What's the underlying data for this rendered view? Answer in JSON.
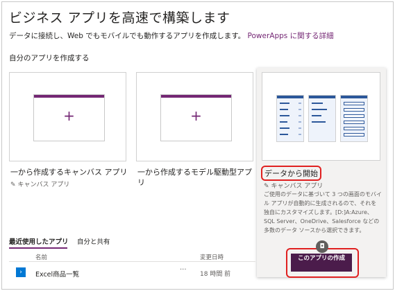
{
  "header": {
    "title": "ビジネス アプリを高速で構築します",
    "subtitle": "データに接続し、Web でもモバイルでも動作するアプリを作成します。",
    "learn_more_link": "PowerApps に関する詳細"
  },
  "create_section": {
    "title": "自分のアプリを作成する",
    "cards": [
      {
        "label": "一から作成するキャンバス アプリ",
        "sub": "キャンバス アプリ",
        "plus_icon": "+"
      },
      {
        "label": "一から作成するモデル駆動型アプリ",
        "plus_icon": "+"
      },
      {
        "label": "データから開始",
        "sub": "キャンバス アプリ",
        "description": "ご使用のデータに基づいて 3 つの画面のモバイル アプリが自動的に生成されるので、それを独自にカスタマイズします。[D:]A:Azure、SQL Server、OneDrive、Salesforce などの多数のデータ ソースから選択できます。",
        "button_label": "このアプリの作成"
      }
    ]
  },
  "tabs": [
    {
      "label": "最近使用したアプリ",
      "active": true
    },
    {
      "label": "自分と共有",
      "active": false
    }
  ],
  "table": {
    "headers": [
      "名前",
      "変更日時"
    ],
    "rows": [
      {
        "name": "Excel商品一覧",
        "modified": "18 時間 前",
        "more": "···"
      }
    ]
  },
  "icons": {
    "pencil": "pencil-icon",
    "app": "app-icon",
    "tour": "tour-icon"
  },
  "colors": {
    "accent": "#742774",
    "button": "#4b1c4b",
    "highlight": "#e02020",
    "app_icon": "#0078d4"
  }
}
